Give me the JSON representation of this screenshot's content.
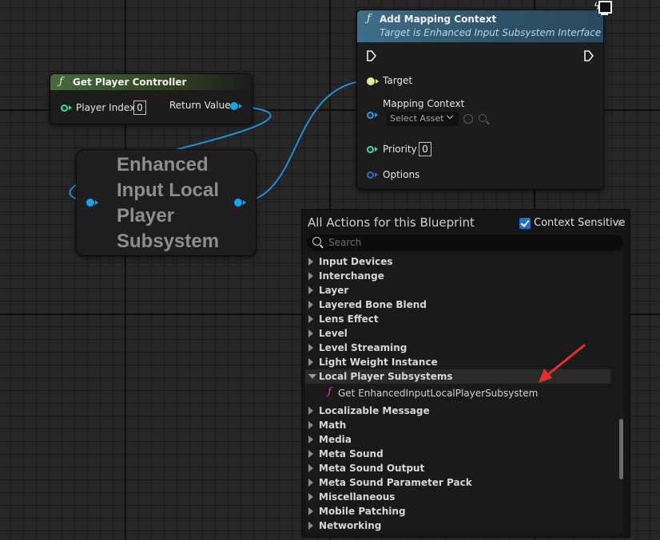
{
  "get_player_controller": {
    "title": "Get Player Controller",
    "player_index_label": "Player Index",
    "player_index_value": "0",
    "return_value_label": "Return Value"
  },
  "enhanced_input_node": {
    "title_lines": [
      "Enhanced",
      "Input Local",
      "Player",
      "Subsystem"
    ]
  },
  "add_mapping_context": {
    "title": "Add Mapping Context",
    "subtitle": "Target is Enhanced Input Subsystem Interface",
    "target_label": "Target",
    "mapping_context_label": "Mapping Context",
    "select_asset_label": "Select Asset",
    "priority_label": "Priority",
    "priority_value": "0",
    "options_label": "Options"
  },
  "actions_menu": {
    "title": "All Actions for this Blueprint",
    "context_sensitive_label": "Context Sensitive",
    "context_sensitive_checked": true,
    "search_placeholder": "Search",
    "categories": [
      "Input Devices",
      "Interchange",
      "Layer",
      "Layered Bone Blend",
      "Lens Effect",
      "Level",
      "Level Streaming",
      "Light Weight Instance",
      "Local Player Subsystems",
      "Get EnhancedInputLocalPlayerSubsystem",
      "Localizable Message",
      "Math",
      "Media",
      "Meta Sound",
      "Meta Sound Output",
      "Meta Sound Parameter Pack",
      "Miscellaneous",
      "Mobile Patching",
      "Networking"
    ]
  },
  "colors": {
    "wire_object": "#1f8fd6",
    "pin_object": "#14a3ee",
    "pin_integer": "#30e0b0",
    "pin_target": "#e6eb9a",
    "pin_struct": "#2f6fc5",
    "function_pink": "#e035b8",
    "arrow_red": "#e53030",
    "checkbox_blue": "#1f6fd0"
  }
}
